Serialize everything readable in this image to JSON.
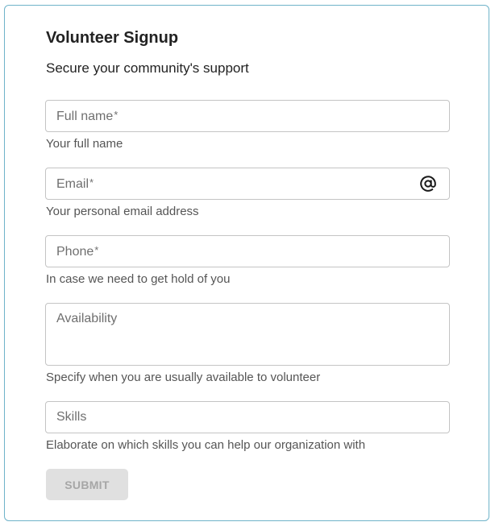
{
  "form": {
    "title": "Volunteer Signup",
    "subtitle": "Secure your community's support",
    "fields": [
      {
        "placeholder": "Full name",
        "required_mark": "*",
        "helper": "Your full name"
      },
      {
        "placeholder": "Email",
        "required_mark": "*",
        "helper": "Your personal email address",
        "icon": "at-sign-icon"
      },
      {
        "placeholder": "Phone",
        "required_mark": "*",
        "helper": "In case we need to get hold of you"
      },
      {
        "placeholder": "Availability",
        "helper": "Specify when you are usually available to volunteer"
      },
      {
        "placeholder": "Skills",
        "helper": "Elaborate on which skills you can help our organization with"
      }
    ],
    "submit_label": "SUBMIT"
  },
  "colors": {
    "card_border": "#6fb3c9",
    "input_border": "#c4c4c4",
    "button_disabled_bg": "#e0e0e0",
    "button_disabled_text": "#a6a6a6"
  }
}
